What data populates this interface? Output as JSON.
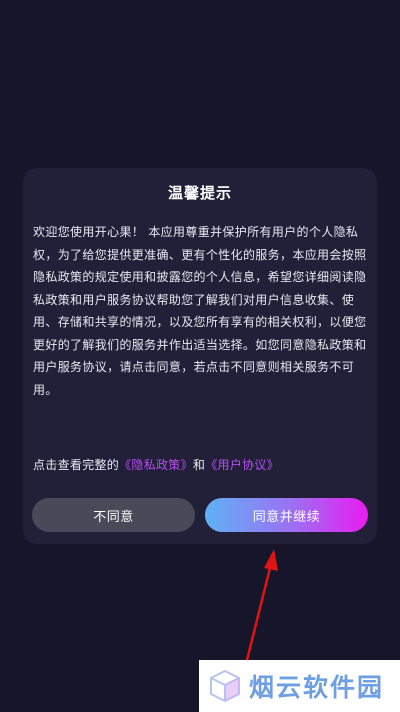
{
  "dialog": {
    "title": "温馨提示",
    "body": "欢迎您使用开心果！ 本应用尊重并保护所有用户的个人隐私权，为了给您提供更准确、更有个性化的服务，本应用会按照隐私政策的规定使用和披露您的个人信息，希望您详细阅读隐私政策和用户服务协议帮助您了解我们对用户信息收集、使用、存储和共享的情况，以及您所有享有的相关权利，以便您更好的了解我们的服务并作出适当选择。如您同意隐私政策和用户服务协议，请点击同意，若点击不同意则相关服务不可用。",
    "links_prefix": "点击查看完整的",
    "privacy_link": "《隐私政策》",
    "links_and": "和",
    "user_agreement_link": "《用户协议》",
    "disagree_label": "不同意",
    "agree_label": "同意并继续"
  },
  "watermark": {
    "text": "烟云软件园"
  },
  "colors": {
    "background": "#17152a",
    "dialog": "#222038",
    "link": "#b84cf4",
    "arrow": "#e01414",
    "watermark_text": "#6e9fe3"
  },
  "icons": {
    "watermark_logo": "cube-logo-icon"
  }
}
